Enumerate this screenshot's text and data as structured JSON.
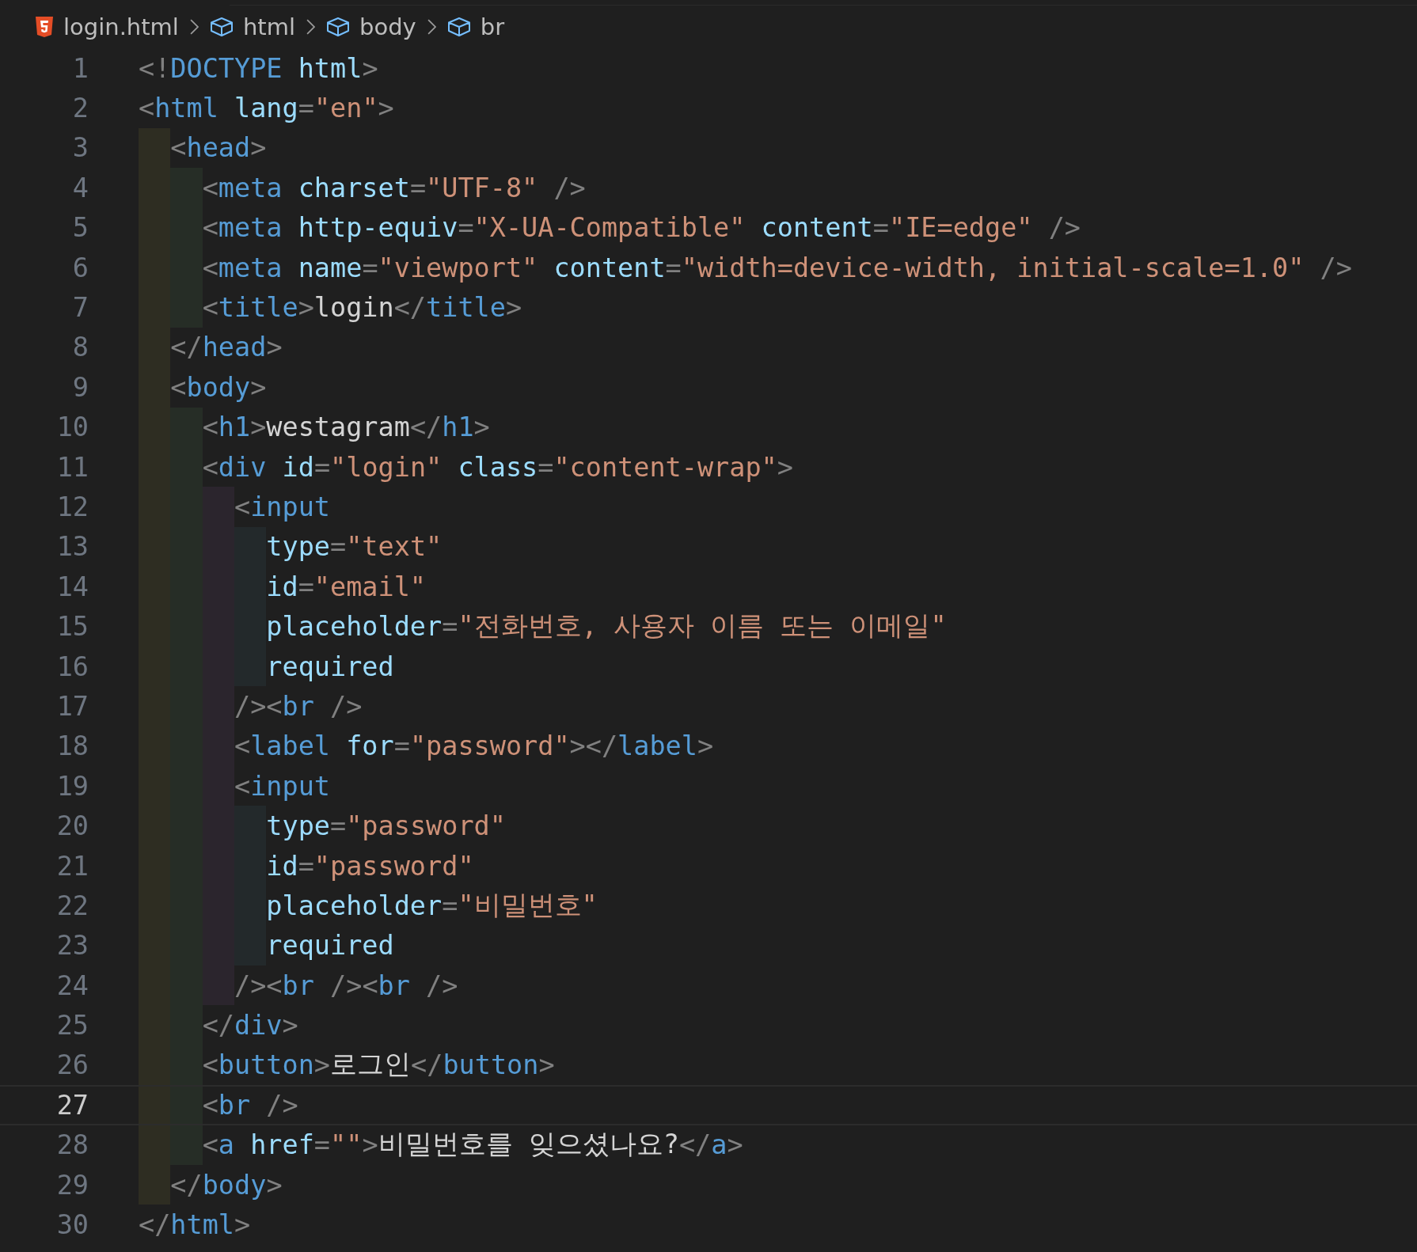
{
  "breadcrumb": [
    {
      "kind": "file",
      "label": "login.html"
    },
    {
      "kind": "element",
      "label": "html"
    },
    {
      "kind": "element",
      "label": "body"
    },
    {
      "kind": "element",
      "label": "br"
    }
  ],
  "lines": [
    {
      "number": "1",
      "current": false,
      "tokens": [
        {
          "kind": "punct",
          "text": "<!"
        },
        {
          "kind": "tag",
          "text": "DOCTYPE"
        },
        {
          "kind": "attr",
          "text": " html"
        },
        {
          "kind": "punct",
          "text": ">"
        }
      ]
    },
    {
      "number": "2",
      "current": false,
      "tokens": [
        {
          "kind": "punct",
          "text": "<"
        },
        {
          "kind": "tag",
          "text": "html"
        },
        {
          "kind": "attr",
          "text": " lang"
        },
        {
          "kind": "punct",
          "text": "="
        },
        {
          "kind": "string",
          "text": "\"en\""
        },
        {
          "kind": "punct",
          "text": ">"
        }
      ]
    },
    {
      "number": "3",
      "current": false,
      "tokens": [
        {
          "kind": "punct",
          "text": "  <"
        },
        {
          "kind": "tag",
          "text": "head"
        },
        {
          "kind": "punct",
          "text": ">"
        }
      ]
    },
    {
      "number": "4",
      "current": false,
      "tokens": [
        {
          "kind": "punct",
          "text": "    <"
        },
        {
          "kind": "tag",
          "text": "meta"
        },
        {
          "kind": "attr",
          "text": " charset"
        },
        {
          "kind": "punct",
          "text": "="
        },
        {
          "kind": "string",
          "text": "\"UTF-8\""
        },
        {
          "kind": "punct",
          "text": " />"
        }
      ]
    },
    {
      "number": "5",
      "current": false,
      "tokens": [
        {
          "kind": "punct",
          "text": "    <"
        },
        {
          "kind": "tag",
          "text": "meta"
        },
        {
          "kind": "attr",
          "text": " http-equiv"
        },
        {
          "kind": "punct",
          "text": "="
        },
        {
          "kind": "string",
          "text": "\"X-UA-Compatible\""
        },
        {
          "kind": "attr",
          "text": " content"
        },
        {
          "kind": "punct",
          "text": "="
        },
        {
          "kind": "string",
          "text": "\"IE=edge\""
        },
        {
          "kind": "punct",
          "text": " />"
        }
      ]
    },
    {
      "number": "6",
      "current": false,
      "tokens": [
        {
          "kind": "punct",
          "text": "    <"
        },
        {
          "kind": "tag",
          "text": "meta"
        },
        {
          "kind": "attr",
          "text": " name"
        },
        {
          "kind": "punct",
          "text": "="
        },
        {
          "kind": "string",
          "text": "\"viewport\""
        },
        {
          "kind": "attr",
          "text": " content"
        },
        {
          "kind": "punct",
          "text": "="
        },
        {
          "kind": "string",
          "text": "\"width=device-width, initial-scale=1.0\""
        },
        {
          "kind": "punct",
          "text": " />"
        }
      ]
    },
    {
      "number": "7",
      "current": false,
      "tokens": [
        {
          "kind": "punct",
          "text": "    <"
        },
        {
          "kind": "tag",
          "text": "title"
        },
        {
          "kind": "punct",
          "text": ">"
        },
        {
          "kind": "text",
          "text": "login"
        },
        {
          "kind": "punct",
          "text": "</"
        },
        {
          "kind": "tag",
          "text": "title"
        },
        {
          "kind": "punct",
          "text": ">"
        }
      ]
    },
    {
      "number": "8",
      "current": false,
      "tokens": [
        {
          "kind": "punct",
          "text": "  </"
        },
        {
          "kind": "tag",
          "text": "head"
        },
        {
          "kind": "punct",
          "text": ">"
        }
      ]
    },
    {
      "number": "9",
      "current": false,
      "tokens": [
        {
          "kind": "punct",
          "text": "  <"
        },
        {
          "kind": "tag",
          "text": "body"
        },
        {
          "kind": "punct",
          "text": ">"
        }
      ]
    },
    {
      "number": "10",
      "current": false,
      "tokens": [
        {
          "kind": "punct",
          "text": "    <"
        },
        {
          "kind": "tag",
          "text": "h1"
        },
        {
          "kind": "punct",
          "text": ">"
        },
        {
          "kind": "text",
          "text": "westagram"
        },
        {
          "kind": "punct",
          "text": "</"
        },
        {
          "kind": "tag",
          "text": "h1"
        },
        {
          "kind": "punct",
          "text": ">"
        }
      ]
    },
    {
      "number": "11",
      "current": false,
      "tokens": [
        {
          "kind": "punct",
          "text": "    <"
        },
        {
          "kind": "tag",
          "text": "div"
        },
        {
          "kind": "attr",
          "text": " id"
        },
        {
          "kind": "punct",
          "text": "="
        },
        {
          "kind": "string",
          "text": "\"login\""
        },
        {
          "kind": "attr",
          "text": " class"
        },
        {
          "kind": "punct",
          "text": "="
        },
        {
          "kind": "string",
          "text": "\"content-wrap\""
        },
        {
          "kind": "punct",
          "text": ">"
        }
      ]
    },
    {
      "number": "12",
      "current": false,
      "tokens": [
        {
          "kind": "punct",
          "text": "      <"
        },
        {
          "kind": "tag",
          "text": "input"
        }
      ]
    },
    {
      "number": "13",
      "current": false,
      "tokens": [
        {
          "kind": "attr",
          "text": "        type"
        },
        {
          "kind": "punct",
          "text": "="
        },
        {
          "kind": "string",
          "text": "\"text\""
        }
      ]
    },
    {
      "number": "14",
      "current": false,
      "tokens": [
        {
          "kind": "attr",
          "text": "        id"
        },
        {
          "kind": "punct",
          "text": "="
        },
        {
          "kind": "string",
          "text": "\"email\""
        }
      ]
    },
    {
      "number": "15",
      "current": false,
      "tokens": [
        {
          "kind": "attr",
          "text": "        placeholder"
        },
        {
          "kind": "punct",
          "text": "="
        },
        {
          "kind": "string",
          "text": "\"전화번호, 사용자 이름 또는 이메일\""
        }
      ]
    },
    {
      "number": "16",
      "current": false,
      "tokens": [
        {
          "kind": "attr",
          "text": "        required"
        }
      ]
    },
    {
      "number": "17",
      "current": false,
      "tokens": [
        {
          "kind": "punct",
          "text": "      /><"
        },
        {
          "kind": "tag",
          "text": "br"
        },
        {
          "kind": "punct",
          "text": " />"
        }
      ]
    },
    {
      "number": "18",
      "current": false,
      "tokens": [
        {
          "kind": "punct",
          "text": "      <"
        },
        {
          "kind": "tag",
          "text": "label"
        },
        {
          "kind": "attr",
          "text": " for"
        },
        {
          "kind": "punct",
          "text": "="
        },
        {
          "kind": "string",
          "text": "\"password\""
        },
        {
          "kind": "punct",
          "text": "></"
        },
        {
          "kind": "tag",
          "text": "label"
        },
        {
          "kind": "punct",
          "text": ">"
        }
      ]
    },
    {
      "number": "19",
      "current": false,
      "tokens": [
        {
          "kind": "punct",
          "text": "      <"
        },
        {
          "kind": "tag",
          "text": "input"
        }
      ]
    },
    {
      "number": "20",
      "current": false,
      "tokens": [
        {
          "kind": "attr",
          "text": "        type"
        },
        {
          "kind": "punct",
          "text": "="
        },
        {
          "kind": "string",
          "text": "\"password\""
        }
      ]
    },
    {
      "number": "21",
      "current": false,
      "tokens": [
        {
          "kind": "attr",
          "text": "        id"
        },
        {
          "kind": "punct",
          "text": "="
        },
        {
          "kind": "string",
          "text": "\"password\""
        }
      ]
    },
    {
      "number": "22",
      "current": false,
      "tokens": [
        {
          "kind": "attr",
          "text": "        placeholder"
        },
        {
          "kind": "punct",
          "text": "="
        },
        {
          "kind": "string",
          "text": "\"비밀번호\""
        }
      ]
    },
    {
      "number": "23",
      "current": false,
      "tokens": [
        {
          "kind": "attr",
          "text": "        required"
        }
      ]
    },
    {
      "number": "24",
      "current": false,
      "tokens": [
        {
          "kind": "punct",
          "text": "      /><"
        },
        {
          "kind": "tag",
          "text": "br"
        },
        {
          "kind": "punct",
          "text": " /><"
        },
        {
          "kind": "tag",
          "text": "br"
        },
        {
          "kind": "punct",
          "text": " />"
        }
      ]
    },
    {
      "number": "25",
      "current": false,
      "tokens": [
        {
          "kind": "punct",
          "text": "    </"
        },
        {
          "kind": "tag",
          "text": "div"
        },
        {
          "kind": "punct",
          "text": ">"
        }
      ]
    },
    {
      "number": "26",
      "current": false,
      "tokens": [
        {
          "kind": "punct",
          "text": "    <"
        },
        {
          "kind": "tag",
          "text": "button"
        },
        {
          "kind": "punct",
          "text": ">"
        },
        {
          "kind": "text",
          "text": "로그인"
        },
        {
          "kind": "punct",
          "text": "</"
        },
        {
          "kind": "tag",
          "text": "button"
        },
        {
          "kind": "punct",
          "text": ">"
        }
      ]
    },
    {
      "number": "27",
      "current": true,
      "tokens": [
        {
          "kind": "punct",
          "text": "    <"
        },
        {
          "kind": "tag",
          "text": "br"
        },
        {
          "kind": "punct",
          "text": " />"
        }
      ]
    },
    {
      "number": "28",
      "current": false,
      "tokens": [
        {
          "kind": "punct",
          "text": "    <"
        },
        {
          "kind": "tag",
          "text": "a"
        },
        {
          "kind": "attr",
          "text": " href"
        },
        {
          "kind": "punct",
          "text": "="
        },
        {
          "kind": "string",
          "text": "\"\""
        },
        {
          "kind": "punct",
          "text": ">"
        },
        {
          "kind": "text",
          "text": "비밀번호를 잊으셨나요?"
        },
        {
          "kind": "punct",
          "text": "</"
        },
        {
          "kind": "tag",
          "text": "a"
        },
        {
          "kind": "punct",
          "text": ">"
        }
      ]
    },
    {
      "number": "29",
      "current": false,
      "tokens": [
        {
          "kind": "punct",
          "text": "  </"
        },
        {
          "kind": "tag",
          "text": "body"
        },
        {
          "kind": "punct",
          "text": ">"
        }
      ]
    },
    {
      "number": "30",
      "current": false,
      "tokens": [
        {
          "kind": "punct",
          "text": "</"
        },
        {
          "kind": "tag",
          "text": "html"
        },
        {
          "kind": "punct",
          "text": ">"
        }
      ]
    }
  ]
}
